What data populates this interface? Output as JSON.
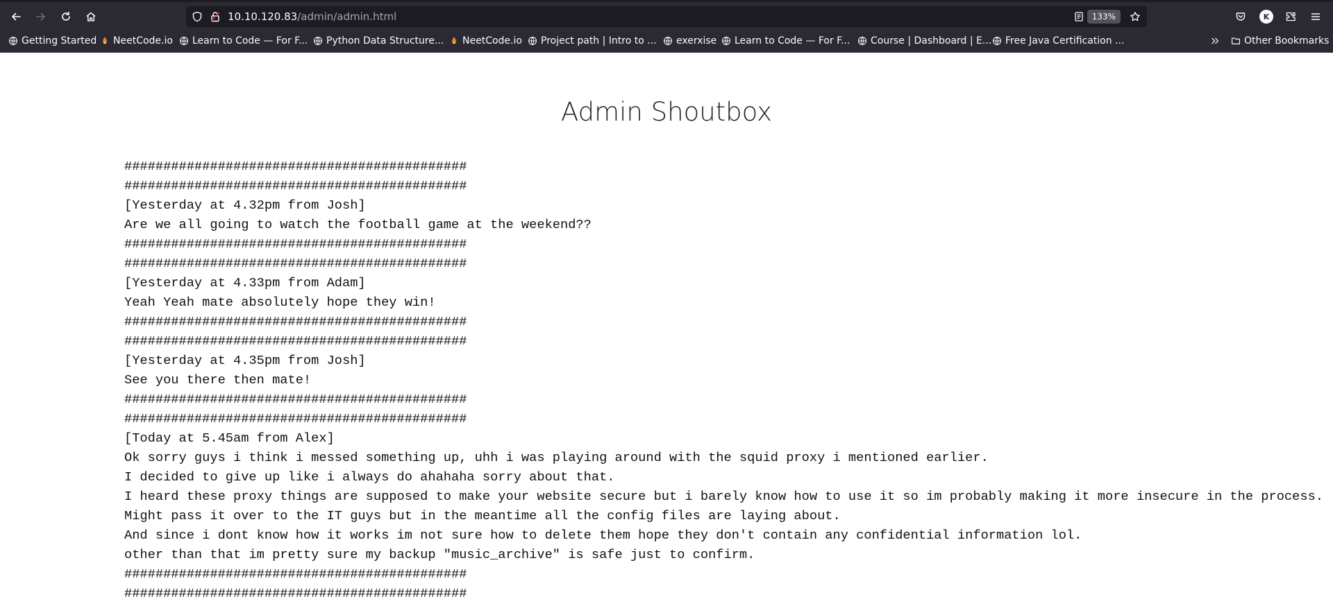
{
  "browser": {
    "url_host": "10.10.120.83",
    "url_path": "/admin/admin.html",
    "zoom": "133%",
    "bookmarks": [
      {
        "label": "Getting Started",
        "icon": "globe-icon"
      },
      {
        "label": "NeetCode.io",
        "icon": "neetcode-icon"
      },
      {
        "label": "Learn to Code — For F...",
        "icon": "globe-icon"
      },
      {
        "label": "Python Data Structure...",
        "icon": "globe-icon"
      },
      {
        "label": "NeetCode.io",
        "icon": "neetcode-icon"
      },
      {
        "label": "Project path | Intro to ...",
        "icon": "globe-icon"
      },
      {
        "label": "exerxise",
        "icon": "globe-icon"
      },
      {
        "label": "Learn to Code — For F...",
        "icon": "globe-icon"
      },
      {
        "label": "Course | Dashboard | E...",
        "icon": "globe-icon"
      },
      {
        "label": "Free Java Certification ...",
        "icon": "globe-icon"
      }
    ],
    "other_bookmarks": "Other Bookmarks",
    "profile_initial": "K"
  },
  "page": {
    "title": "Admin Shoutbox",
    "lines": [
      "############################################",
      "############################################",
      "[Yesterday at 4.32pm from Josh]",
      "Are we all going to watch the football game at the weekend??",
      "############################################",
      "############################################",
      "[Yesterday at 4.33pm from Adam]",
      "Yeah Yeah mate absolutely hope they win!",
      "############################################",
      "############################################",
      "[Yesterday at 4.35pm from Josh]",
      "See you there then mate!",
      "############################################",
      "############################################",
      "[Today at 5.45am from Alex]",
      "Ok sorry guys i think i messed something up, uhh i was playing around with the squid proxy i mentioned earlier.",
      "I decided to give up like i always do ahahaha sorry about that.",
      "I heard these proxy things are supposed to make your website secure but i barely know how to use it so im probably making it more insecure in the process.",
      "Might pass it over to the IT guys but in the meantime all the config files are laying about.",
      "And since i dont know how it works im not sure how to delete them hope they don't contain any confidential information lol.",
      "other than that im pretty sure my backup \"music_archive\" is safe just to confirm.",
      "############################################",
      "############################################"
    ]
  }
}
